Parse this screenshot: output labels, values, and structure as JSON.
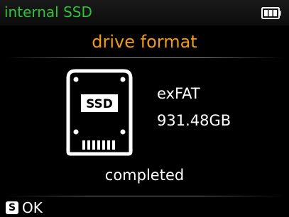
{
  "header": {
    "title": "internal SSD",
    "battery_icon": "battery-full-icon",
    "title_color": "#2fc23a"
  },
  "page": {
    "title": "drive format",
    "title_color": "#f09a1c"
  },
  "drive": {
    "icon": "ssd-icon",
    "icon_label": "SSD",
    "filesystem": "exFAT",
    "capacity": "931.48GB"
  },
  "status": {
    "text": "completed"
  },
  "footer": {
    "key_icon": "s-key-icon",
    "key_glyph": "S",
    "action_label": "OK"
  }
}
